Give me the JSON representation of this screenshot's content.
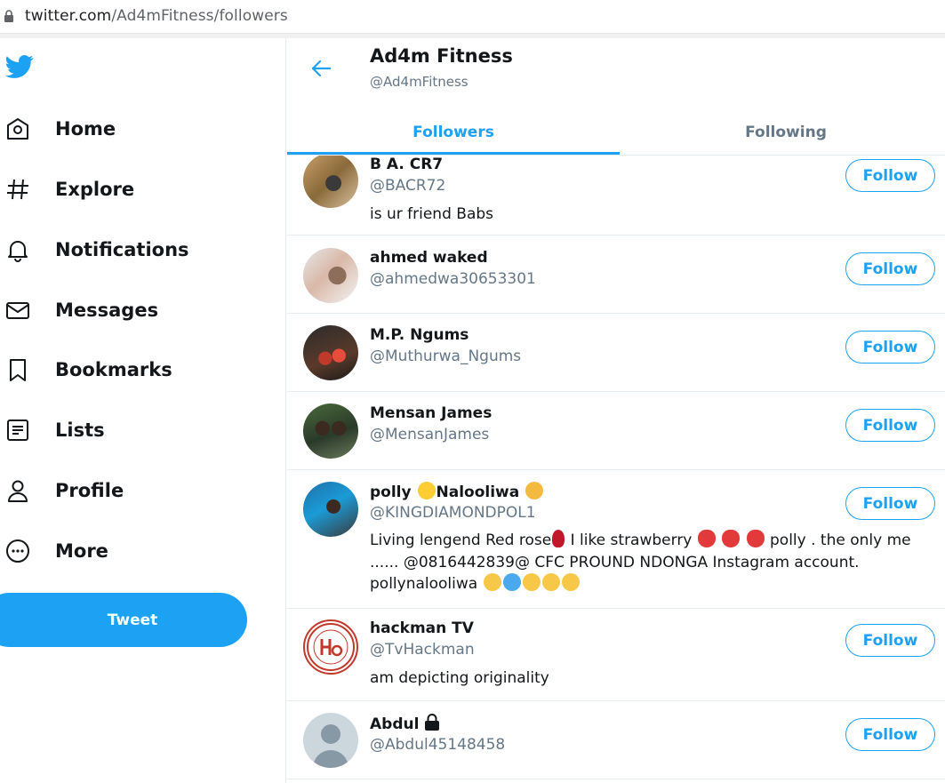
{
  "browser": {
    "url_host": "twitter.com",
    "url_path": "/Ad4mFitness/followers"
  },
  "sidebar": {
    "items": [
      {
        "label": "Home",
        "icon": "home-icon"
      },
      {
        "label": "Explore",
        "icon": "hashtag-icon"
      },
      {
        "label": "Notifications",
        "icon": "bell-icon"
      },
      {
        "label": "Messages",
        "icon": "envelope-icon"
      },
      {
        "label": "Bookmarks",
        "icon": "bookmark-icon"
      },
      {
        "label": "Lists",
        "icon": "list-icon"
      },
      {
        "label": "Profile",
        "icon": "person-icon"
      },
      {
        "label": "More",
        "icon": "more-icon"
      }
    ],
    "tweet_label": "Tweet"
  },
  "header": {
    "name": "Ad4m Fitness",
    "handle": "@Ad4mFitness",
    "tabs": [
      {
        "label": "Followers",
        "active": true
      },
      {
        "label": "Following",
        "active": false
      }
    ]
  },
  "followers": [
    {
      "name": "B A. CR7",
      "handle": "@BACR72",
      "bio": "is ur friend Babs",
      "button": "Follow"
    },
    {
      "name": "ahmed waked",
      "handle": "@ahmedwa30653301",
      "bio": "",
      "button": "Follow"
    },
    {
      "name": "M.P. Ngums",
      "handle": "@Muthurwa_Ngums",
      "bio": "",
      "button": "Follow"
    },
    {
      "name": "Mensan James",
      "handle": "@MensanJames",
      "bio": "",
      "button": "Follow"
    },
    {
      "name_part1": "polly ",
      "name_part2": "Nalooliwa ",
      "handle": "@KINGDIAMONDPOL1",
      "bio_line1_a": "Living lengend Red rose",
      "bio_line1_b": " I like strawberry ",
      "bio_line1_c": " polly . the only me",
      "bio_line2": "...... @0816442839@ CFC PROUND NDONGA Instagram account.",
      "bio_line3": "pollynalooliwa ",
      "button": "Follow"
    },
    {
      "name": "hackman TV",
      "handle": "@TvHackman",
      "bio": "am depicting originality",
      "button": "Follow"
    },
    {
      "name": "Abdul",
      "handle": "@Abdul45148458",
      "bio": "",
      "button": "Follow"
    }
  ],
  "colors": {
    "accent": "#1da1f2",
    "text_primary": "#14171a",
    "text_secondary": "#657786",
    "border": "#e6ecf0"
  }
}
